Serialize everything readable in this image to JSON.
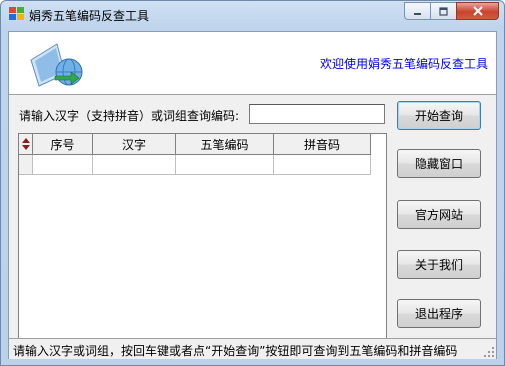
{
  "window": {
    "title": "娟秀五笔编码反查工具",
    "icon": "app-icon",
    "controls": [
      "minimize-icon",
      "maximize-icon",
      "close-icon"
    ]
  },
  "banner": {
    "icon": "globe-arrow-icon",
    "welcome": "欢迎使用娟秀五笔编码反查工具"
  },
  "query": {
    "label": "请输入汉字（支持拼音）或词组查询编码:",
    "value": "",
    "placeholder": ""
  },
  "table": {
    "corner_icon": "sort-arrows-icon",
    "columns": [
      "序号",
      "汉字",
      "五笔编码",
      "拼音码"
    ],
    "rows": [
      [
        "",
        "",
        "",
        ""
      ]
    ]
  },
  "buttons": {
    "search": "开始查询",
    "hide": "隐藏窗口",
    "website": "官方网站",
    "about": "关于我们",
    "exit": "退出程序"
  },
  "statusbar": {
    "text": "请输入汉字或词组，按回车键或者点“开始查询”按钮即可查询到五笔编码和拼音编码"
  },
  "colors": {
    "welcome_text": "#0000ee",
    "close_button": "#c9442d",
    "title_bar": "#bed3ec"
  }
}
